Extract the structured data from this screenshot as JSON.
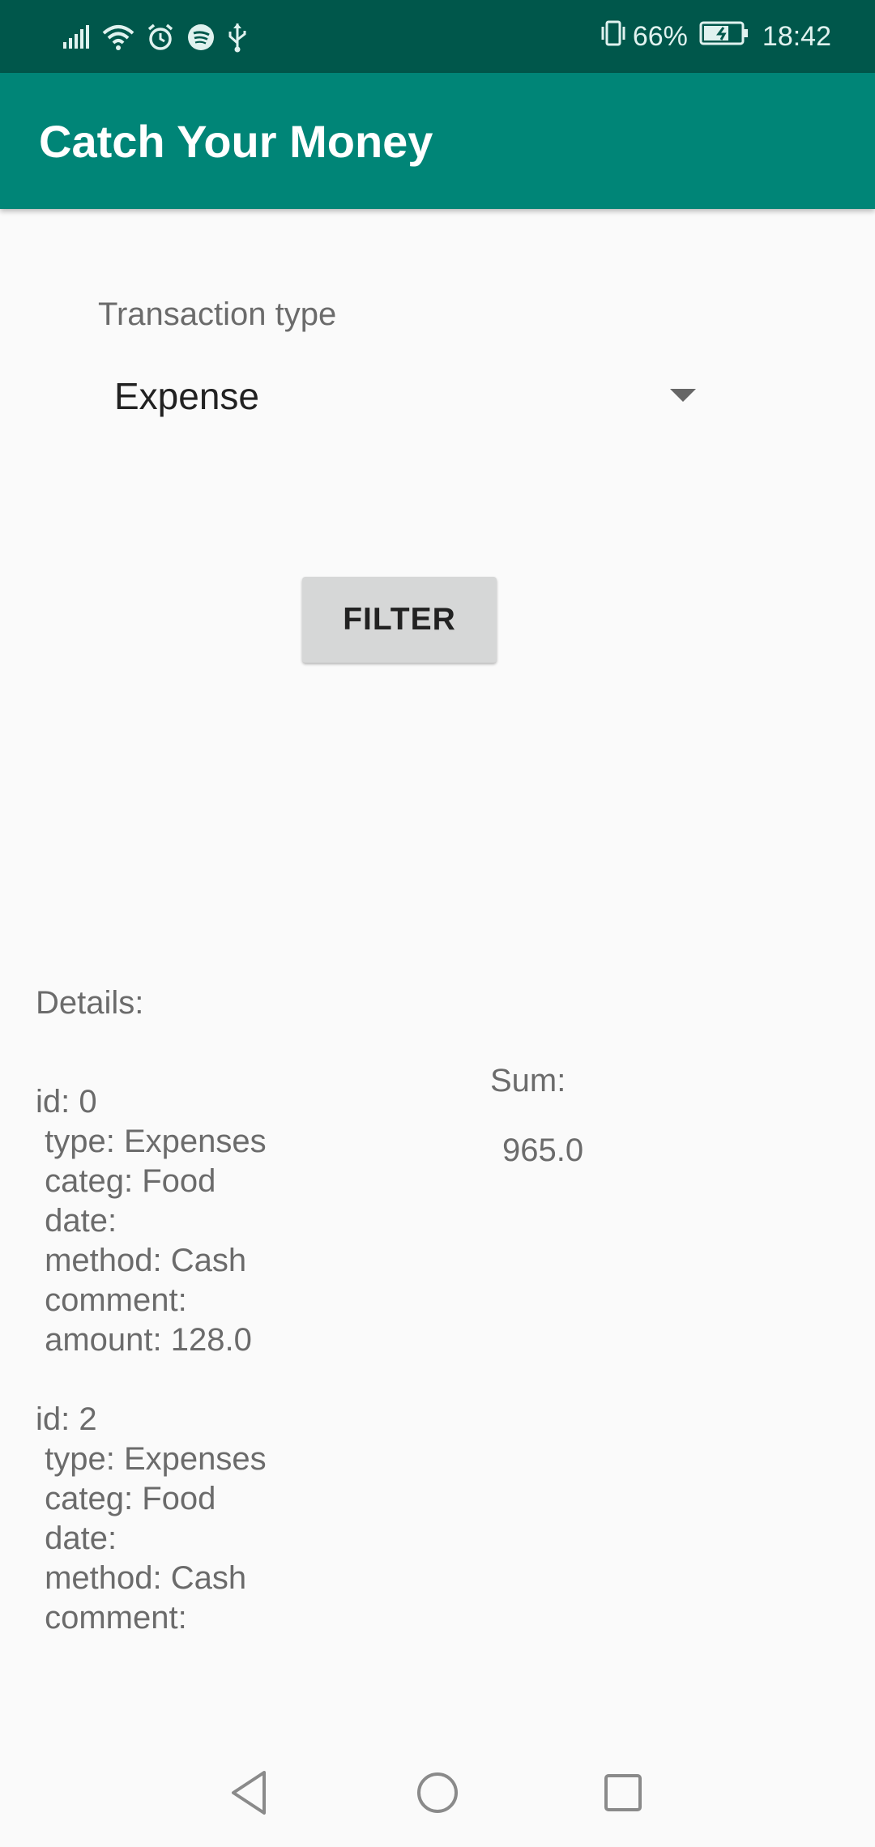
{
  "status_bar": {
    "icons": [
      "signal-icon",
      "wifi-icon",
      "alarm-icon",
      "spotify-icon",
      "usb-icon",
      "vibrate-icon",
      "battery-icon"
    ],
    "battery_percent": "66%",
    "time": "18:42"
  },
  "app_bar": {
    "title": "Catch Your Money",
    "color": "#008577",
    "status_color": "#00574b"
  },
  "filter": {
    "label": "Transaction type",
    "selected": "Expense",
    "button_label": "FILTER"
  },
  "details": {
    "label": "Details:",
    "records": [
      {
        "lines": [
          "id: 0",
          " type: Expenses",
          " categ: Food",
          " date: ",
          " method: Cash",
          " comment: ",
          " amount: 128.0"
        ]
      },
      {
        "lines": [
          "id: 2",
          " type: Expenses",
          " categ: Food",
          " date: ",
          " method: Cash",
          " comment: "
        ]
      }
    ]
  },
  "summary": {
    "label": "Sum:",
    "value": " 965.0"
  },
  "nav_bar": {
    "buttons": [
      "back-icon",
      "home-icon",
      "recents-icon"
    ]
  }
}
